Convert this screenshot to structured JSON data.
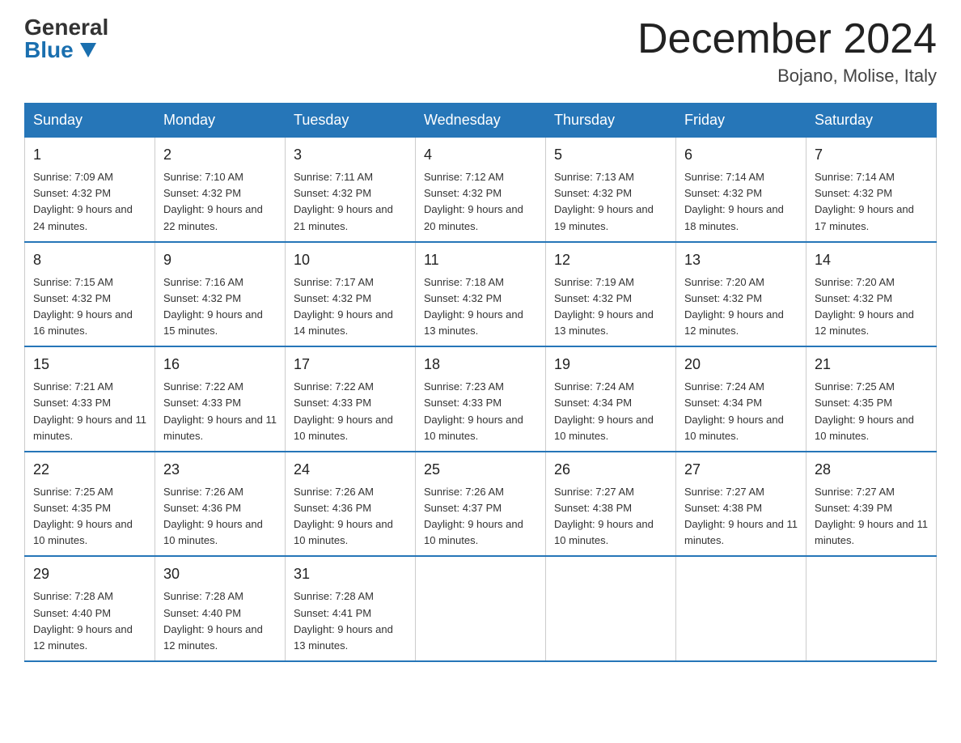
{
  "header": {
    "logo_general": "General",
    "logo_blue": "Blue",
    "month_title": "December 2024",
    "location": "Bojano, Molise, Italy"
  },
  "days_of_week": [
    "Sunday",
    "Monday",
    "Tuesday",
    "Wednesday",
    "Thursday",
    "Friday",
    "Saturday"
  ],
  "weeks": [
    [
      {
        "day": "1",
        "sunrise": "7:09 AM",
        "sunset": "4:32 PM",
        "daylight": "9 hours and 24 minutes."
      },
      {
        "day": "2",
        "sunrise": "7:10 AM",
        "sunset": "4:32 PM",
        "daylight": "9 hours and 22 minutes."
      },
      {
        "day": "3",
        "sunrise": "7:11 AM",
        "sunset": "4:32 PM",
        "daylight": "9 hours and 21 minutes."
      },
      {
        "day": "4",
        "sunrise": "7:12 AM",
        "sunset": "4:32 PM",
        "daylight": "9 hours and 20 minutes."
      },
      {
        "day": "5",
        "sunrise": "7:13 AM",
        "sunset": "4:32 PM",
        "daylight": "9 hours and 19 minutes."
      },
      {
        "day": "6",
        "sunrise": "7:14 AM",
        "sunset": "4:32 PM",
        "daylight": "9 hours and 18 minutes."
      },
      {
        "day": "7",
        "sunrise": "7:14 AM",
        "sunset": "4:32 PM",
        "daylight": "9 hours and 17 minutes."
      }
    ],
    [
      {
        "day": "8",
        "sunrise": "7:15 AM",
        "sunset": "4:32 PM",
        "daylight": "9 hours and 16 minutes."
      },
      {
        "day": "9",
        "sunrise": "7:16 AM",
        "sunset": "4:32 PM",
        "daylight": "9 hours and 15 minutes."
      },
      {
        "day": "10",
        "sunrise": "7:17 AM",
        "sunset": "4:32 PM",
        "daylight": "9 hours and 14 minutes."
      },
      {
        "day": "11",
        "sunrise": "7:18 AM",
        "sunset": "4:32 PM",
        "daylight": "9 hours and 13 minutes."
      },
      {
        "day": "12",
        "sunrise": "7:19 AM",
        "sunset": "4:32 PM",
        "daylight": "9 hours and 13 minutes."
      },
      {
        "day": "13",
        "sunrise": "7:20 AM",
        "sunset": "4:32 PM",
        "daylight": "9 hours and 12 minutes."
      },
      {
        "day": "14",
        "sunrise": "7:20 AM",
        "sunset": "4:32 PM",
        "daylight": "9 hours and 12 minutes."
      }
    ],
    [
      {
        "day": "15",
        "sunrise": "7:21 AM",
        "sunset": "4:33 PM",
        "daylight": "9 hours and 11 minutes."
      },
      {
        "day": "16",
        "sunrise": "7:22 AM",
        "sunset": "4:33 PM",
        "daylight": "9 hours and 11 minutes."
      },
      {
        "day": "17",
        "sunrise": "7:22 AM",
        "sunset": "4:33 PM",
        "daylight": "9 hours and 10 minutes."
      },
      {
        "day": "18",
        "sunrise": "7:23 AM",
        "sunset": "4:33 PM",
        "daylight": "9 hours and 10 minutes."
      },
      {
        "day": "19",
        "sunrise": "7:24 AM",
        "sunset": "4:34 PM",
        "daylight": "9 hours and 10 minutes."
      },
      {
        "day": "20",
        "sunrise": "7:24 AM",
        "sunset": "4:34 PM",
        "daylight": "9 hours and 10 minutes."
      },
      {
        "day": "21",
        "sunrise": "7:25 AM",
        "sunset": "4:35 PM",
        "daylight": "9 hours and 10 minutes."
      }
    ],
    [
      {
        "day": "22",
        "sunrise": "7:25 AM",
        "sunset": "4:35 PM",
        "daylight": "9 hours and 10 minutes."
      },
      {
        "day": "23",
        "sunrise": "7:26 AM",
        "sunset": "4:36 PM",
        "daylight": "9 hours and 10 minutes."
      },
      {
        "day": "24",
        "sunrise": "7:26 AM",
        "sunset": "4:36 PM",
        "daylight": "9 hours and 10 minutes."
      },
      {
        "day": "25",
        "sunrise": "7:26 AM",
        "sunset": "4:37 PM",
        "daylight": "9 hours and 10 minutes."
      },
      {
        "day": "26",
        "sunrise": "7:27 AM",
        "sunset": "4:38 PM",
        "daylight": "9 hours and 10 minutes."
      },
      {
        "day": "27",
        "sunrise": "7:27 AM",
        "sunset": "4:38 PM",
        "daylight": "9 hours and 11 minutes."
      },
      {
        "day": "28",
        "sunrise": "7:27 AM",
        "sunset": "4:39 PM",
        "daylight": "9 hours and 11 minutes."
      }
    ],
    [
      {
        "day": "29",
        "sunrise": "7:28 AM",
        "sunset": "4:40 PM",
        "daylight": "9 hours and 12 minutes."
      },
      {
        "day": "30",
        "sunrise": "7:28 AM",
        "sunset": "4:40 PM",
        "daylight": "9 hours and 12 minutes."
      },
      {
        "day": "31",
        "sunrise": "7:28 AM",
        "sunset": "4:41 PM",
        "daylight": "9 hours and 13 minutes."
      },
      null,
      null,
      null,
      null
    ]
  ]
}
